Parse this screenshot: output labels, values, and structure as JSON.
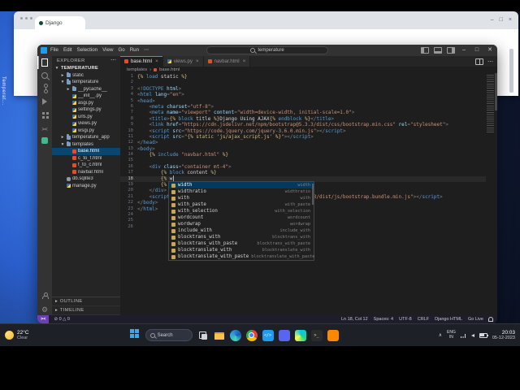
{
  "desktop": {
    "side_label": "Temperat..."
  },
  "background_window": {
    "tab_label": "Django",
    "controls": [
      "–",
      "□",
      "×"
    ]
  },
  "colors": {
    "accent_blue": "#0078d4",
    "selection_blue": "#094771",
    "django_teal": "#44b78b",
    "html_orange": "#e44d26",
    "status_remote_purple": "#6c3eb8"
  },
  "vscode": {
    "titlebar": {
      "menus": [
        "File",
        "Edit",
        "Selection",
        "View",
        "Go",
        "Run",
        "⋯"
      ],
      "search": "temperature",
      "controls": [
        "–",
        "□",
        "✕"
      ]
    },
    "activity_icons": [
      "explorer",
      "search",
      "source-control",
      "run-debug",
      "extensions",
      "remote",
      "django-extension",
      "account",
      "settings-gear"
    ],
    "explorer": {
      "title": "EXPLORER",
      "sections": [
        "OUTLINE",
        "TIMELINE"
      ],
      "items": [
        {
          "label": "TEMPERATURE",
          "depth": 0,
          "state": "expanded",
          "kind": "root"
        },
        {
          "label": "static",
          "depth": 1,
          "state": "collapsed",
          "kind": "folder"
        },
        {
          "label": "temperature",
          "depth": 1,
          "state": "expanded",
          "kind": "folder"
        },
        {
          "label": "__pycache__",
          "depth": 2,
          "state": "collapsed",
          "kind": "folder"
        },
        {
          "label": "__init__.py",
          "depth": 2,
          "kind": "py"
        },
        {
          "label": "asgi.py",
          "depth": 2,
          "kind": "py"
        },
        {
          "label": "settings.py",
          "depth": 2,
          "kind": "py"
        },
        {
          "label": "urls.py",
          "depth": 2,
          "kind": "py"
        },
        {
          "label": "views.py",
          "depth": 2,
          "kind": "py"
        },
        {
          "label": "wsgi.py",
          "depth": 2,
          "kind": "py"
        },
        {
          "label": "temperature_app",
          "depth": 1,
          "state": "collapsed",
          "kind": "folder"
        },
        {
          "label": "templates",
          "depth": 1,
          "state": "expanded",
          "kind": "folder"
        },
        {
          "label": "base.html",
          "depth": 2,
          "kind": "html",
          "selected": true
        },
        {
          "label": "c_to_f.html",
          "depth": 2,
          "kind": "html"
        },
        {
          "label": "f_to_c.html",
          "depth": 2,
          "kind": "html"
        },
        {
          "label": "navbar.html",
          "depth": 2,
          "kind": "html"
        },
        {
          "label": "db.sqlite3",
          "depth": 1,
          "kind": "db"
        },
        {
          "label": "manage.py",
          "depth": 1,
          "kind": "py"
        }
      ]
    },
    "tabs": [
      {
        "label": "base.html",
        "icon": "html",
        "active": true
      },
      {
        "label": "views.py",
        "icon": "py",
        "active": false
      },
      {
        "label": "navbar.html",
        "icon": "html",
        "active": false
      }
    ],
    "breadcrumb": [
      "templates",
      "base.html"
    ],
    "code": {
      "lines": [
        {
          "n": 1,
          "tokens": [
            [
              "d",
              "{% "
            ],
            [
              "t",
              "load"
            ],
            [
              "w",
              " static "
            ],
            [
              "d",
              "%}"
            ]
          ]
        },
        {
          "n": 2,
          "tokens": []
        },
        {
          "n": 3,
          "tokens": [
            [
              "g",
              "<!"
            ],
            [
              "t",
              "DOCTYPE"
            ],
            [
              "a",
              " html"
            ],
            [
              "g",
              ">"
            ]
          ]
        },
        {
          "n": 4,
          "tokens": [
            [
              "g",
              "<"
            ],
            [
              "t",
              "html"
            ],
            [
              "a",
              " lang"
            ],
            [
              "g",
              "="
            ],
            [
              "s",
              "\"en\""
            ],
            [
              "g",
              ">"
            ]
          ]
        },
        {
          "n": 5,
          "tokens": [
            [
              "g",
              "<"
            ],
            [
              "t",
              "head"
            ],
            [
              "g",
              ">"
            ]
          ]
        },
        {
          "n": 6,
          "tokens": [
            [
              "w",
              "    "
            ],
            [
              "g",
              "<"
            ],
            [
              "t",
              "meta"
            ],
            [
              "a",
              " charset"
            ],
            [
              "g",
              "="
            ],
            [
              "s",
              "\"utf-8\""
            ],
            [
              "g",
              ">"
            ]
          ]
        },
        {
          "n": 7,
          "tokens": [
            [
              "w",
              "    "
            ],
            [
              "g",
              "<"
            ],
            [
              "t",
              "meta"
            ],
            [
              "a",
              " name"
            ],
            [
              "g",
              "="
            ],
            [
              "s",
              "\"viewport\""
            ],
            [
              "a",
              " content"
            ],
            [
              "g",
              "="
            ],
            [
              "s",
              "\"width=device-width, initial-scale=1.0\""
            ],
            [
              "g",
              ">"
            ]
          ]
        },
        {
          "n": 8,
          "tokens": [
            [
              "w",
              "    "
            ],
            [
              "g",
              "<"
            ],
            [
              "t",
              "title"
            ],
            [
              "g",
              ">"
            ],
            [
              "d",
              "{% "
            ],
            [
              "t",
              "block"
            ],
            [
              "w",
              " title "
            ],
            [
              "d",
              "%}"
            ],
            [
              "w",
              "Django Using AJAX"
            ],
            [
              "d",
              "{% "
            ],
            [
              "t",
              "endblock"
            ],
            [
              "d",
              " %}"
            ],
            [
              "g",
              "</"
            ],
            [
              "t",
              "title"
            ],
            [
              "g",
              ">"
            ]
          ]
        },
        {
          "n": 9,
          "tokens": [
            [
              "w",
              "    "
            ],
            [
              "g",
              "<"
            ],
            [
              "t",
              "link"
            ],
            [
              "a",
              " href"
            ],
            [
              "g",
              "="
            ],
            [
              "s",
              "\"https://cdn.jsdelivr.net/npm/bootstrap@5.3.3/dist/css/bootstrap.min.css\""
            ],
            [
              "a",
              " rel"
            ],
            [
              "g",
              "="
            ],
            [
              "s",
              "\"stylesheet\""
            ],
            [
              "g",
              ">"
            ]
          ]
        },
        {
          "n": 10,
          "tokens": [
            [
              "w",
              "    "
            ],
            [
              "g",
              "<"
            ],
            [
              "t",
              "script"
            ],
            [
              "a",
              " src"
            ],
            [
              "g",
              "="
            ],
            [
              "s",
              "\"https://code.jquery.com/jquery-3.6.0.min.js\""
            ],
            [
              "g",
              "></"
            ],
            [
              "t",
              "script"
            ],
            [
              "g",
              ">"
            ]
          ]
        },
        {
          "n": 11,
          "tokens": [
            [
              "w",
              "    "
            ],
            [
              "g",
              "<"
            ],
            [
              "t",
              "script"
            ],
            [
              "a",
              " src"
            ],
            [
              "g",
              "="
            ],
            [
              "s",
              "\""
            ],
            [
              "d",
              "{% static 'js/ajax_script.js' %}"
            ],
            [
              "s",
              "\""
            ],
            [
              "g",
              "></"
            ],
            [
              "t",
              "script"
            ],
            [
              "g",
              ">"
            ]
          ]
        },
        {
          "n": 12,
          "tokens": [
            [
              "g",
              "</"
            ],
            [
              "t",
              "head"
            ],
            [
              "g",
              ">"
            ]
          ]
        },
        {
          "n": 13,
          "tokens": [
            [
              "g",
              "<"
            ],
            [
              "t",
              "body"
            ],
            [
              "g",
              ">"
            ]
          ]
        },
        {
          "n": 14,
          "tokens": [
            [
              "w",
              "    "
            ],
            [
              "d",
              "{% "
            ],
            [
              "t",
              "include"
            ],
            [
              "s",
              " \"navbar.html\" "
            ],
            [
              "d",
              "%}"
            ]
          ]
        },
        {
          "n": 15,
          "tokens": []
        },
        {
          "n": 16,
          "tokens": [
            [
              "w",
              "    "
            ],
            [
              "g",
              "<"
            ],
            [
              "t",
              "div"
            ],
            [
              "a",
              " class"
            ],
            [
              "g",
              "="
            ],
            [
              "s",
              "\"container mt-4\""
            ],
            [
              "g",
              ">"
            ]
          ]
        },
        {
          "n": 17,
          "tokens": [
            [
              "w",
              "        "
            ],
            [
              "d",
              "{% "
            ],
            [
              "t",
              "block"
            ],
            [
              "w",
              " content "
            ],
            [
              "d",
              "%}"
            ]
          ]
        },
        {
          "n": 18,
          "tokens": [
            [
              "w",
              "        "
            ],
            [
              "d",
              "{% "
            ],
            [
              "w",
              "w"
            ]
          ],
          "caret": true,
          "current": true
        },
        {
          "n": 19,
          "tokens": [
            [
              "w",
              "        "
            ],
            [
              "d",
              "{% endblock %}"
            ]
          ]
        },
        {
          "n": 20,
          "tokens": [
            [
              "w",
              "    "
            ],
            [
              "g",
              "</"
            ],
            [
              "t",
              "div"
            ],
            [
              "g",
              ">"
            ]
          ]
        },
        {
          "n": 21,
          "tokens": [
            [
              "w",
              "    "
            ],
            [
              "g",
              "<"
            ],
            [
              "t",
              "script"
            ],
            [
              "a",
              " src"
            ],
            [
              "g",
              "="
            ],
            [
              "s",
              "\"https://cdn.jsdelivr.net/npm/bootstrap@5.3.3/dist/js/bootstrap.bundle.min.js\""
            ],
            [
              "g",
              "></"
            ],
            [
              "t",
              "script"
            ],
            [
              "g",
              ">"
            ]
          ]
        },
        {
          "n": 22,
          "tokens": [
            [
              "g",
              "</"
            ],
            [
              "t",
              "body"
            ],
            [
              "g",
              ">"
            ]
          ]
        },
        {
          "n": 23,
          "tokens": [
            [
              "g",
              "</"
            ],
            [
              "t",
              "html"
            ],
            [
              "g",
              ">"
            ]
          ]
        },
        {
          "n": 24,
          "tokens": []
        },
        {
          "n": 25,
          "tokens": []
        },
        {
          "n": 26,
          "tokens": []
        }
      ]
    },
    "suggest": {
      "items": [
        {
          "label": "width",
          "detail": "width",
          "selected": true
        },
        {
          "label": "widthratio",
          "detail": "widthratio"
        },
        {
          "label": "with",
          "detail": "with"
        },
        {
          "label": "with_paste",
          "detail": "with_paste"
        },
        {
          "label": "with_selection",
          "detail": "with_selection"
        },
        {
          "label": "wordcount",
          "detail": "wordcount"
        },
        {
          "label": "wordwrap",
          "detail": "wordwrap"
        },
        {
          "label": "include_with",
          "detail": "include_with"
        },
        {
          "label": "blocktrans_with",
          "detail": "blocktrans_with"
        },
        {
          "label": "blocktrans_with_paste",
          "detail": "blocktrans_with_paste"
        },
        {
          "label": "blocktranslate_with",
          "detail": "blocktranslate_with"
        },
        {
          "label": "blocktranslate_with_paste",
          "detail": "blocktranslate_with_paste"
        }
      ]
    },
    "status": {
      "problems": "⊘ 0  △ 0",
      "right": [
        "Ln 18, Col 12",
        "Spaces: 4",
        "UTF-8",
        "CRLF",
        "Django HTML",
        "Go Live"
      ]
    }
  },
  "taskbar": {
    "weather": {
      "temp": "22°C",
      "cond": "Clear"
    },
    "search": "Search",
    "icons": [
      {
        "name": "task-view"
      },
      {
        "name": "file-explorer"
      },
      {
        "name": "edge"
      },
      {
        "name": "chrome"
      },
      {
        "name": "vscode"
      },
      {
        "name": "discord"
      },
      {
        "name": "pycharm"
      },
      {
        "name": "terminal"
      },
      {
        "name": "vlc"
      }
    ],
    "tray": {
      "lang1": "ENG",
      "lang2": "IN",
      "time": "20:03",
      "date": "05-12-2023"
    }
  }
}
